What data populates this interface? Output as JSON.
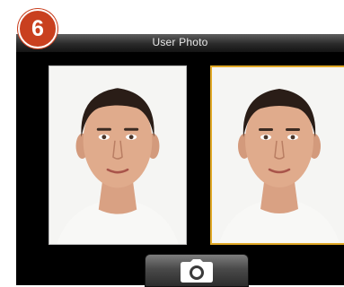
{
  "step_badge": {
    "number": "6"
  },
  "screen": {
    "title": "User Photo"
  },
  "photos": [
    {
      "id": "left",
      "selected": false
    },
    {
      "id": "right",
      "selected": true
    }
  ],
  "colors": {
    "selection_border": "#e0a826",
    "badge": "#c9401f"
  },
  "icons": {
    "capture": "camera-icon"
  }
}
